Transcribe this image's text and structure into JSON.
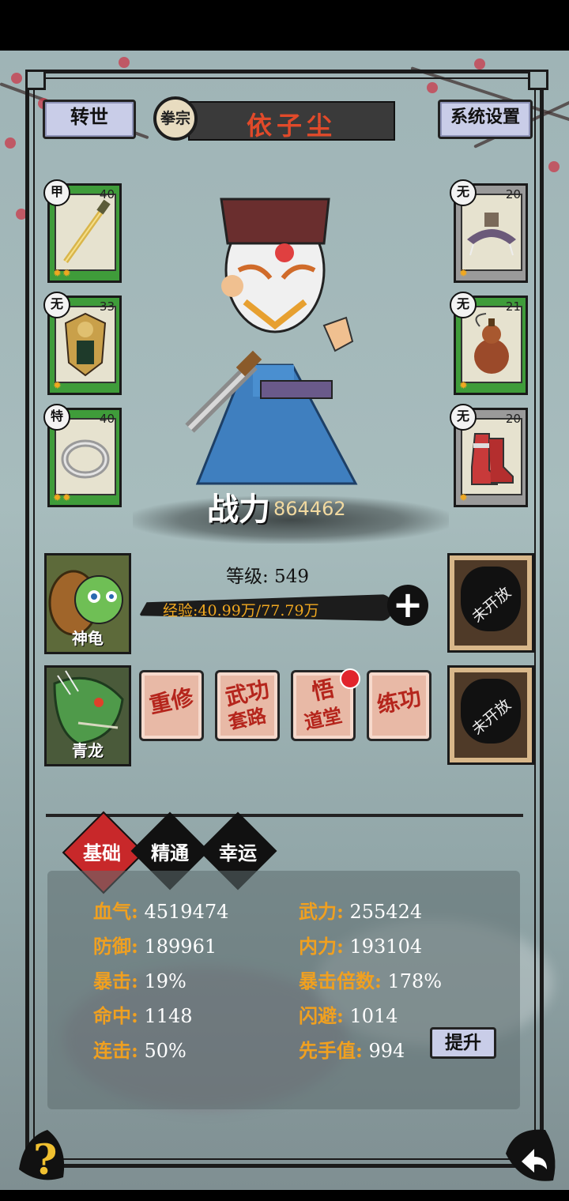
{
  "header": {
    "reincarnate_label": "转世",
    "school_badge": "拳宗",
    "player_name": "依子尘",
    "settings_label": "系统设置"
  },
  "equipment": {
    "left": [
      {
        "tag": "甲",
        "level": "40",
        "stars": "✹✹",
        "item": "sword",
        "frame": "green"
      },
      {
        "tag": "无",
        "level": "33",
        "stars": "✹",
        "item": "armor",
        "frame": "green"
      },
      {
        "tag": "特",
        "level": "40",
        "stars": "✹✹",
        "item": "ring",
        "frame": "green"
      }
    ],
    "right": [
      {
        "tag": "无",
        "level": "20",
        "stars": "✹",
        "item": "hat",
        "frame": "gray"
      },
      {
        "tag": "无",
        "level": "21",
        "stars": "✹",
        "item": "gourd",
        "frame": "green"
      },
      {
        "tag": "无",
        "level": "20",
        "stars": "✹",
        "item": "boots",
        "frame": "gray"
      }
    ]
  },
  "power": {
    "label": "战力",
    "value": "864462"
  },
  "progress": {
    "level_text": "等级: 549",
    "exp_text": "经验:40.99万/77.79万",
    "exp_fraction": 0.527
  },
  "pets": [
    {
      "name": "神龟",
      "icon": "turtle-pet"
    },
    {
      "name": "青龙",
      "icon": "dragon-pet"
    }
  ],
  "locked_slots": [
    {
      "label": "未开放"
    },
    {
      "label": "未开放"
    }
  ],
  "actions": {
    "rebuild": "重修",
    "martial_line1": "武功",
    "martial_line2": "套路",
    "hall_line1": "悟",
    "hall_line2": "道堂",
    "train": "练功"
  },
  "tabs": [
    {
      "label": "基础",
      "active": true
    },
    {
      "label": "精通",
      "active": false
    },
    {
      "label": "幸运",
      "active": false
    }
  ],
  "stats": {
    "hp_key": "血气:",
    "hp_val": "4519474",
    "atk_key": "武力:",
    "atk_val": "255424",
    "def_key": "防御:",
    "def_val": "189961",
    "inner_key": "内力:",
    "inner_val": "193104",
    "crit_key": "暴击:",
    "crit_val": "19%",
    "critmult_key": "暴击倍数:",
    "critmult_val": "178%",
    "hit_key": "命中:",
    "hit_val": "1148",
    "dodge_key": "闪避:",
    "dodge_val": "1014",
    "combo_key": "连击:",
    "combo_val": "50%",
    "init_key": "先手值:",
    "init_val": "994",
    "raise_label": "提升"
  },
  "footer": {
    "help": "?",
    "back_icon": "back-arrow-icon"
  },
  "colors": {
    "accent_red": "#e14a2a",
    "stat_key": "#f0a020",
    "tab_active": "#c8282a",
    "frame_green": "#3f9c3a"
  }
}
